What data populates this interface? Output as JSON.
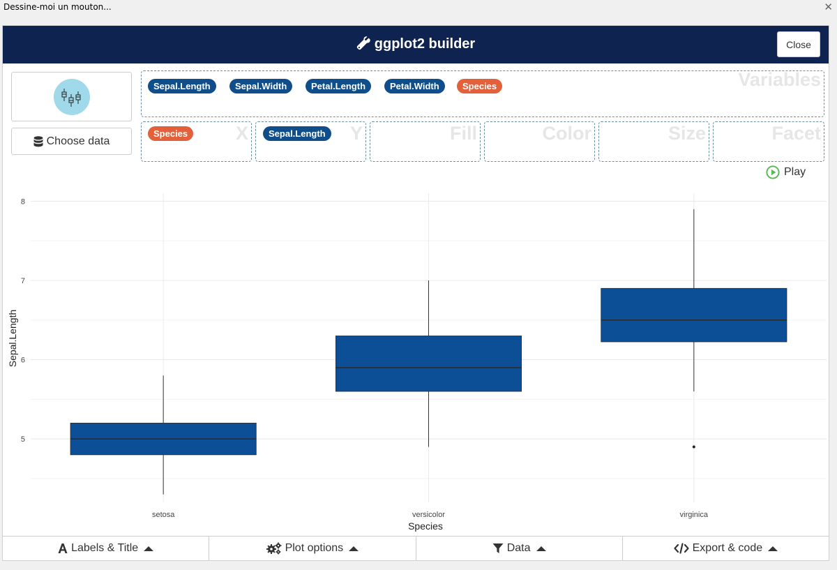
{
  "window": {
    "title": "Dessine-moi un mouton...",
    "close_glyph": "✕"
  },
  "header": {
    "title": "ggplot2 builder",
    "icon": "wrench-icon",
    "close_label": "Close"
  },
  "sidebar": {
    "geom_icon": "boxplot-icon",
    "choose_data_label": "Choose data",
    "choose_data_icon": "database-icon"
  },
  "variables": {
    "label": "Variables",
    "items": [
      {
        "name": "Sepal.Length",
        "type": "numeric"
      },
      {
        "name": "Sepal.Width",
        "type": "numeric"
      },
      {
        "name": "Petal.Length",
        "type": "numeric"
      },
      {
        "name": "Petal.Width",
        "type": "numeric"
      },
      {
        "name": "Species",
        "type": "factor"
      }
    ]
  },
  "aesthetics": [
    {
      "label": "X",
      "value": "Species",
      "type": "factor"
    },
    {
      "label": "Y",
      "value": "Sepal.Length",
      "type": "numeric"
    },
    {
      "label": "Fill",
      "value": ""
    },
    {
      "label": "Color",
      "value": ""
    },
    {
      "label": "Size",
      "value": ""
    },
    {
      "label": "Facet",
      "value": ""
    }
  ],
  "play": {
    "label": "Play",
    "icon": "play-circle-icon"
  },
  "colors": {
    "numeric": "#0f4e8a",
    "factor": "#e2603a",
    "box_fill": "#0c4f97",
    "header": "#0f2350",
    "play": "#5cb85c"
  },
  "chart_data": {
    "type": "boxplot",
    "title": "",
    "xlabel": "Species",
    "ylabel": "Sepal.Length",
    "categories": [
      "setosa",
      "versicolor",
      "virginica"
    ],
    "ylim": [
      4.2,
      8.1
    ],
    "yticks": [
      5,
      6,
      7,
      8
    ],
    "grid": true,
    "boxes": [
      {
        "category": "setosa",
        "min": 4.3,
        "q1": 4.8,
        "median": 5.0,
        "q3": 5.2,
        "max": 5.8,
        "outliers": []
      },
      {
        "category": "versicolor",
        "min": 4.9,
        "q1": 5.6,
        "median": 5.9,
        "q3": 6.3,
        "max": 7.0,
        "outliers": []
      },
      {
        "category": "virginica",
        "min": 5.6,
        "q1": 6.225,
        "median": 6.5,
        "q3": 6.9,
        "max": 7.9,
        "outliers": [
          4.9
        ]
      }
    ]
  },
  "footer": {
    "tabs": [
      {
        "label": "Labels & Title",
        "icon": "font-icon"
      },
      {
        "label": "Plot options",
        "icon": "gears-icon"
      },
      {
        "label": "Data",
        "icon": "filter-icon"
      },
      {
        "label": "Export & code",
        "icon": "code-icon"
      }
    ]
  }
}
